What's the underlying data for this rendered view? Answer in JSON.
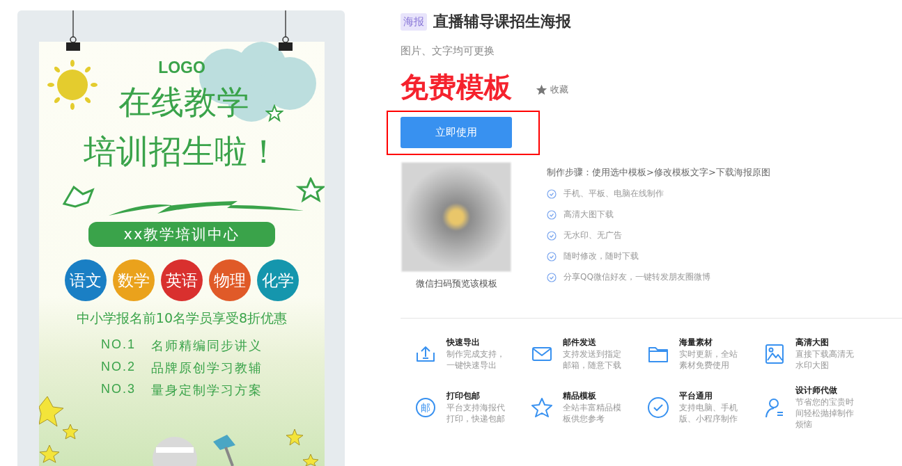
{
  "poster": {
    "logo": "LOGO",
    "headline": [
      "在线教学",
      "培训招生啦！"
    ],
    "banner": "xx教学培训中心",
    "subjects": [
      {
        "label": "语文",
        "color": "#1a7fc4"
      },
      {
        "label": "数学",
        "color": "#eaa21c"
      },
      {
        "label": "英语",
        "color": "#d9302e"
      },
      {
        "label": "物理",
        "color": "#e05a28"
      },
      {
        "label": "化学",
        "color": "#1596ad"
      }
    ],
    "offer": "中小学报名前10名学员享受8折优惠",
    "highlights": [
      {
        "number": "NO.1",
        "text": "名师精编同步讲义"
      },
      {
        "number": "NO.2",
        "text": "品牌原创学习教辅"
      },
      {
        "number": "NO.3",
        "text": "量身定制学习方案"
      }
    ]
  },
  "detail": {
    "tag": "海报",
    "title": "直播辅导课招生海报",
    "subtitle": "图片、文字均可更换",
    "price_label": "免费模板",
    "favorite": "收藏",
    "use_button": "立即使用",
    "qr_caption": "微信扫码预览该模板",
    "steps_title": "制作步骤：使用选中模板>修改模板文字>下载海报原图",
    "benefits": [
      "手机、平板、电脑在线制作",
      "高清大图下载",
      "无水印、无广告",
      "随时修改，随时下载",
      "分享QQ微信好友，一键转发朋友圈微博"
    ]
  },
  "features": [
    {
      "kind": "export",
      "title": "快速导出",
      "description": "制作完成支持，一键快速导出"
    },
    {
      "kind": "mail",
      "title": "邮件发送",
      "description": "支持发送到指定邮箱，随意下载"
    },
    {
      "kind": "folder",
      "title": "海量素材",
      "description": "实时更新，全站素材免费使用"
    },
    {
      "kind": "image",
      "title": "高清大图",
      "description": "直接下载高清无水印大图"
    },
    {
      "kind": "seal",
      "glyph": "邮",
      "title": "打印包邮",
      "description": "平台支持海报代打印，快递包邮"
    },
    {
      "kind": "star",
      "title": "精品模板",
      "description": "全站丰富精品模板供您参考"
    },
    {
      "kind": "check",
      "title": "平台通用",
      "description": "支持电脑、手机版、小程序制作"
    },
    {
      "kind": "person",
      "title": "设计师代做",
      "description": "节省您的宝贵时间轻松抛掉制作烦恼"
    }
  ]
}
